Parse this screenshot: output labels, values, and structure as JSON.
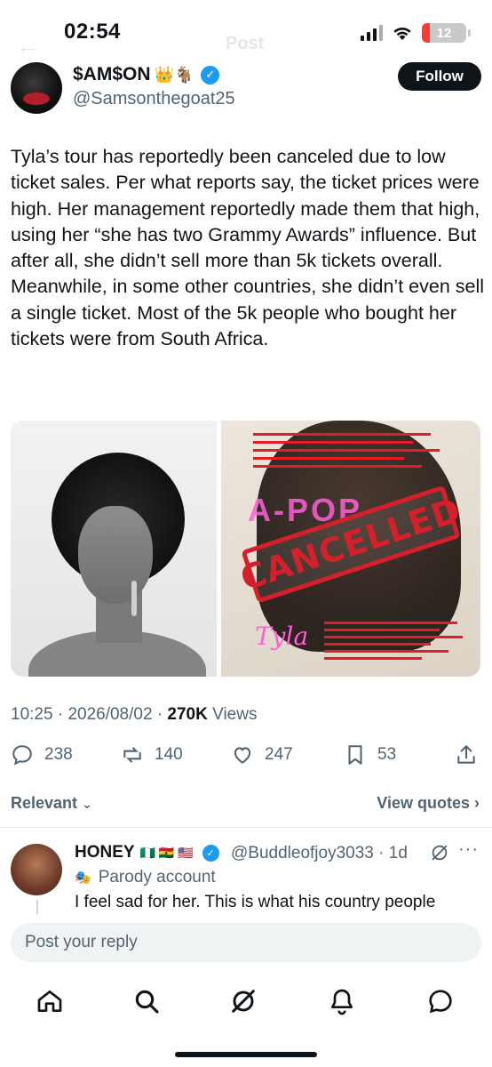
{
  "status_bar": {
    "time": "02:54",
    "battery_level": "12",
    "icons": [
      "signal-icon",
      "wifi-icon",
      "battery-icon"
    ]
  },
  "header": {
    "title": "Post",
    "back_icon": "arrow-left-icon"
  },
  "author": {
    "name": "$AM$ON",
    "name_emojis": "👑🐐",
    "handle": "@Samsonthegoat25",
    "verified": true,
    "follow_label": "Follow"
  },
  "tweet": {
    "text": "Tyla’s tour has reportedly been canceled due to low ticket sales. Per what reports say, the ticket prices were high. Her management reportedly made them that high, using her “she has two Grammy Awards” influence. But after all, she didn’t sell more than 5k tickets overall. Meanwhile, in some other countries, she didn’t even sell a single ticket. Most of the 5k people who bought her tickets were from South Africa.",
    "images": {
      "right": {
        "stamp_text": "CANCELLED",
        "logo_text": "A-POP",
        "signature": "Tyla"
      }
    },
    "time": "10:25",
    "date": "2026/08/02",
    "views_count": "270K",
    "views_label": "Views"
  },
  "actions": {
    "replies": "238",
    "reposts": "140",
    "likes": "247",
    "bookmarks": "53"
  },
  "replies_header": {
    "sort_label": "Relevant",
    "view_quotes_label": "View quotes"
  },
  "reply": {
    "name": "HONEY",
    "flags": "🇳🇬 🇬🇭 🇺🇸",
    "verified": true,
    "handle": "@Buddleofjoy3033",
    "time": "1d",
    "badge_label": "Parody account",
    "text": "I feel sad for her. This is what his country people"
  },
  "reply_box": {
    "placeholder": "Post your reply"
  },
  "bottom_nav": [
    "home-icon",
    "search-icon",
    "grok-icon",
    "notifications-icon",
    "messages-icon"
  ],
  "colors": {
    "text": "#0f1419",
    "secondary": "#536471",
    "verified_blue": "#1d9bf0",
    "stamp_red": "#d4202b",
    "battery_red": "#ff3b30"
  }
}
